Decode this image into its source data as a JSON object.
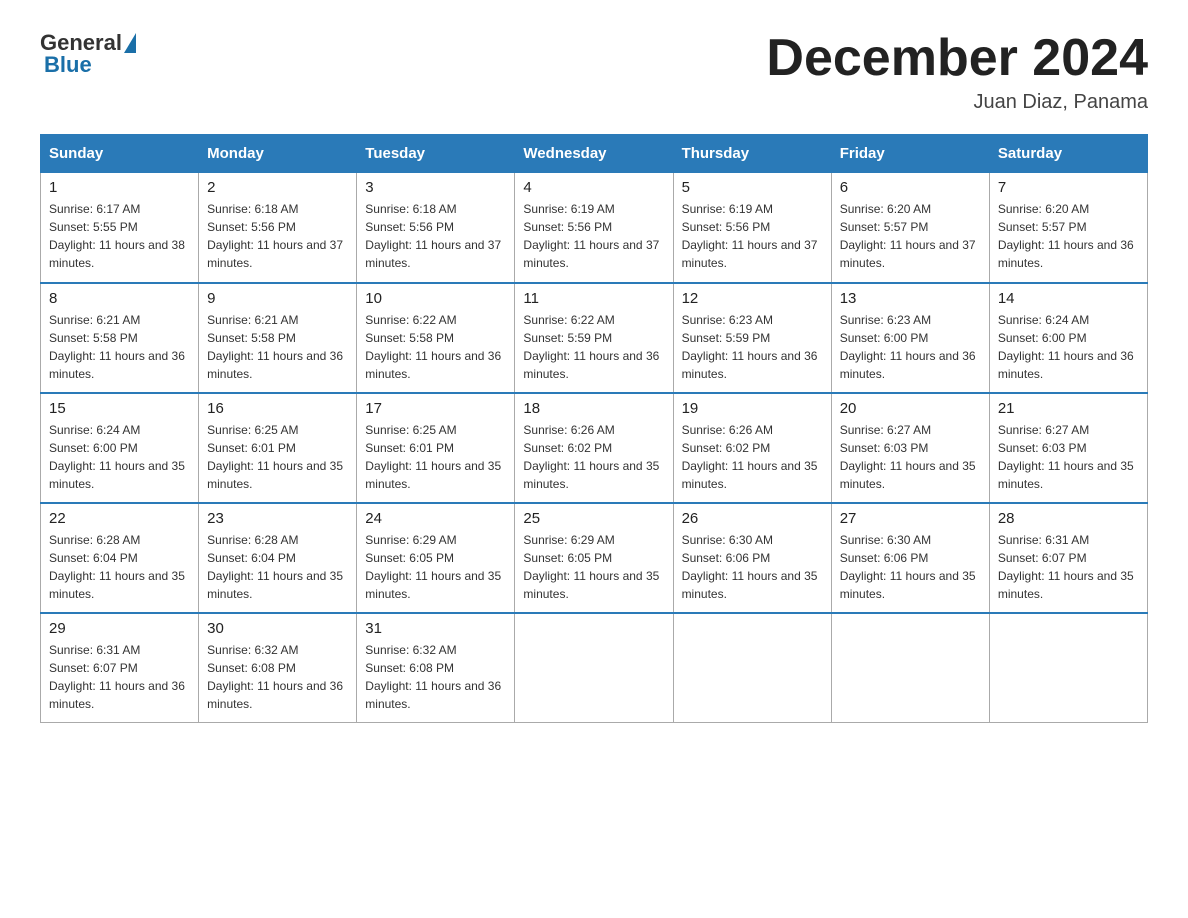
{
  "header": {
    "logo_general": "General",
    "logo_blue": "Blue",
    "month_title": "December 2024",
    "location": "Juan Diaz, Panama"
  },
  "days_of_week": [
    "Sunday",
    "Monday",
    "Tuesday",
    "Wednesday",
    "Thursday",
    "Friday",
    "Saturday"
  ],
  "weeks": [
    [
      {
        "day": "1",
        "sunrise": "6:17 AM",
        "sunset": "5:55 PM",
        "daylight": "11 hours and 38 minutes."
      },
      {
        "day": "2",
        "sunrise": "6:18 AM",
        "sunset": "5:56 PM",
        "daylight": "11 hours and 37 minutes."
      },
      {
        "day": "3",
        "sunrise": "6:18 AM",
        "sunset": "5:56 PM",
        "daylight": "11 hours and 37 minutes."
      },
      {
        "day": "4",
        "sunrise": "6:19 AM",
        "sunset": "5:56 PM",
        "daylight": "11 hours and 37 minutes."
      },
      {
        "day": "5",
        "sunrise": "6:19 AM",
        "sunset": "5:56 PM",
        "daylight": "11 hours and 37 minutes."
      },
      {
        "day": "6",
        "sunrise": "6:20 AM",
        "sunset": "5:57 PM",
        "daylight": "11 hours and 37 minutes."
      },
      {
        "day": "7",
        "sunrise": "6:20 AM",
        "sunset": "5:57 PM",
        "daylight": "11 hours and 36 minutes."
      }
    ],
    [
      {
        "day": "8",
        "sunrise": "6:21 AM",
        "sunset": "5:58 PM",
        "daylight": "11 hours and 36 minutes."
      },
      {
        "day": "9",
        "sunrise": "6:21 AM",
        "sunset": "5:58 PM",
        "daylight": "11 hours and 36 minutes."
      },
      {
        "day": "10",
        "sunrise": "6:22 AM",
        "sunset": "5:58 PM",
        "daylight": "11 hours and 36 minutes."
      },
      {
        "day": "11",
        "sunrise": "6:22 AM",
        "sunset": "5:59 PM",
        "daylight": "11 hours and 36 minutes."
      },
      {
        "day": "12",
        "sunrise": "6:23 AM",
        "sunset": "5:59 PM",
        "daylight": "11 hours and 36 minutes."
      },
      {
        "day": "13",
        "sunrise": "6:23 AM",
        "sunset": "6:00 PM",
        "daylight": "11 hours and 36 minutes."
      },
      {
        "day": "14",
        "sunrise": "6:24 AM",
        "sunset": "6:00 PM",
        "daylight": "11 hours and 36 minutes."
      }
    ],
    [
      {
        "day": "15",
        "sunrise": "6:24 AM",
        "sunset": "6:00 PM",
        "daylight": "11 hours and 35 minutes."
      },
      {
        "day": "16",
        "sunrise": "6:25 AM",
        "sunset": "6:01 PM",
        "daylight": "11 hours and 35 minutes."
      },
      {
        "day": "17",
        "sunrise": "6:25 AM",
        "sunset": "6:01 PM",
        "daylight": "11 hours and 35 minutes."
      },
      {
        "day": "18",
        "sunrise": "6:26 AM",
        "sunset": "6:02 PM",
        "daylight": "11 hours and 35 minutes."
      },
      {
        "day": "19",
        "sunrise": "6:26 AM",
        "sunset": "6:02 PM",
        "daylight": "11 hours and 35 minutes."
      },
      {
        "day": "20",
        "sunrise": "6:27 AM",
        "sunset": "6:03 PM",
        "daylight": "11 hours and 35 minutes."
      },
      {
        "day": "21",
        "sunrise": "6:27 AM",
        "sunset": "6:03 PM",
        "daylight": "11 hours and 35 minutes."
      }
    ],
    [
      {
        "day": "22",
        "sunrise": "6:28 AM",
        "sunset": "6:04 PM",
        "daylight": "11 hours and 35 minutes."
      },
      {
        "day": "23",
        "sunrise": "6:28 AM",
        "sunset": "6:04 PM",
        "daylight": "11 hours and 35 minutes."
      },
      {
        "day": "24",
        "sunrise": "6:29 AM",
        "sunset": "6:05 PM",
        "daylight": "11 hours and 35 minutes."
      },
      {
        "day": "25",
        "sunrise": "6:29 AM",
        "sunset": "6:05 PM",
        "daylight": "11 hours and 35 minutes."
      },
      {
        "day": "26",
        "sunrise": "6:30 AM",
        "sunset": "6:06 PM",
        "daylight": "11 hours and 35 minutes."
      },
      {
        "day": "27",
        "sunrise": "6:30 AM",
        "sunset": "6:06 PM",
        "daylight": "11 hours and 35 minutes."
      },
      {
        "day": "28",
        "sunrise": "6:31 AM",
        "sunset": "6:07 PM",
        "daylight": "11 hours and 35 minutes."
      }
    ],
    [
      {
        "day": "29",
        "sunrise": "6:31 AM",
        "sunset": "6:07 PM",
        "daylight": "11 hours and 36 minutes."
      },
      {
        "day": "30",
        "sunrise": "6:32 AM",
        "sunset": "6:08 PM",
        "daylight": "11 hours and 36 minutes."
      },
      {
        "day": "31",
        "sunrise": "6:32 AM",
        "sunset": "6:08 PM",
        "daylight": "11 hours and 36 minutes."
      },
      {
        "day": "",
        "sunrise": "",
        "sunset": "",
        "daylight": ""
      },
      {
        "day": "",
        "sunrise": "",
        "sunset": "",
        "daylight": ""
      },
      {
        "day": "",
        "sunrise": "",
        "sunset": "",
        "daylight": ""
      },
      {
        "day": "",
        "sunrise": "",
        "sunset": "",
        "daylight": ""
      }
    ]
  ],
  "labels": {
    "sunrise": "Sunrise:",
    "sunset": "Sunset:",
    "daylight": "Daylight:"
  }
}
